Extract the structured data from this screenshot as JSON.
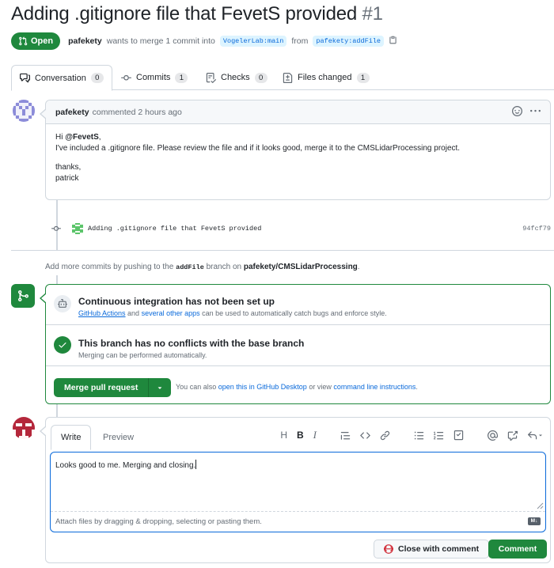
{
  "pr": {
    "title": "Adding .gitignore file that FevetS provided",
    "number": "#1",
    "state": "Open",
    "author": "pafekety",
    "merge_text": "wants to merge 1 commit into",
    "base_branch": "VogelerLab:main",
    "from_text": "from",
    "head_branch": "pafekety:addFile"
  },
  "tabs": [
    {
      "label": "Conversation",
      "count": "0",
      "icon": "comment-discussion-icon"
    },
    {
      "label": "Commits",
      "count": "1",
      "icon": "git-commit-icon"
    },
    {
      "label": "Checks",
      "count": "0",
      "icon": "checklist-icon"
    },
    {
      "label": "Files changed",
      "count": "1",
      "icon": "file-diff-icon"
    }
  ],
  "comment": {
    "author": "pafekety",
    "meta": "commented 2 hours ago",
    "greeting_prefix": "Hi ",
    "mention": "@FevetS",
    "greeting_suffix": ",",
    "line2": "I've included a .gitignore file. Please review the file and if it looks good, merge it to the CMSLidarProcessing project.",
    "line3": "thanks,",
    "line4": "patrick"
  },
  "commit": {
    "message": "Adding .gitignore file that FevetS provided",
    "sha": "94fcf79"
  },
  "hint": {
    "prefix": "Add more commits by pushing to the",
    "branch": "addFile",
    "middle": "branch on",
    "repo": "pafekety/CMSLidarProcessing",
    "suffix": "."
  },
  "merge": {
    "ci_title": "Continuous integration has not been set up",
    "ci_link1": "GitHub Actions",
    "ci_and": "and",
    "ci_link2": "several other apps",
    "ci_rest": "can be used to automatically catch bugs and enforce style.",
    "conflict_title": "This branch has no conflicts with the base branch",
    "conflict_sub": "Merging can be performed automatically.",
    "button": "Merge pull request",
    "also_prefix": "You can also",
    "also_link1": "open this in GitHub Desktop",
    "also_or": "or view",
    "also_link2": "command line instructions",
    "also_suffix": "."
  },
  "editor": {
    "write_tab": "Write",
    "preview_tab": "Preview",
    "text": "Looks good to me. Merging and closing.",
    "attach_hint": "Attach files by dragging & dropping, selecting or pasting them.",
    "md_badge": "M↓",
    "toolbar": {
      "heading": "H",
      "bold": "B",
      "italic": "I"
    },
    "close_button": "Close with comment",
    "comment_button": "Comment"
  },
  "colors": {
    "green": "#1f883d",
    "link": "#0969da",
    "muted": "#656d76",
    "border": "#d0d7de"
  }
}
